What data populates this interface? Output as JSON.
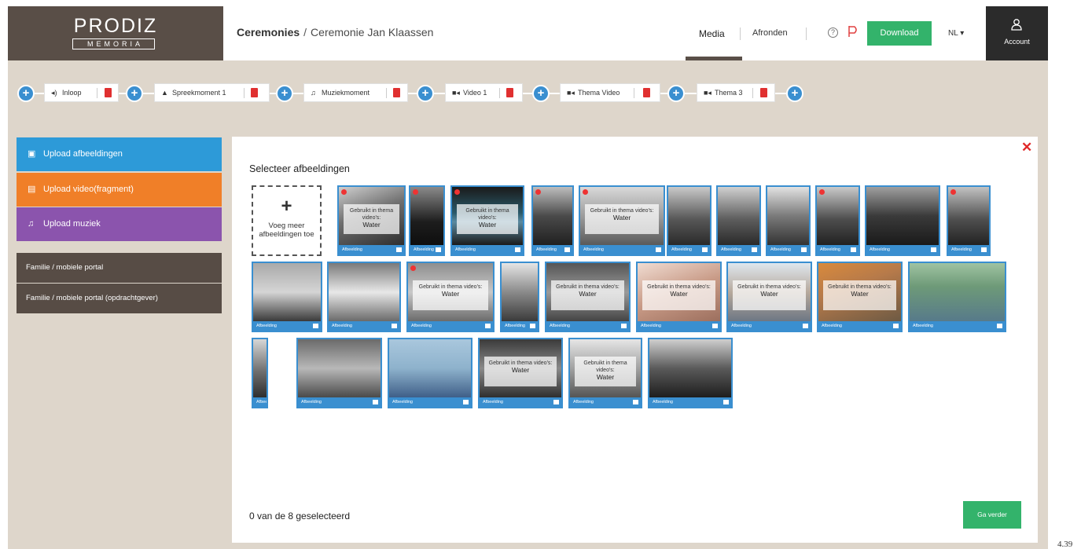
{
  "logo": {
    "main": "PRODIZ",
    "sub": "MEMORIA"
  },
  "breadcrumb": {
    "root": "Ceremonies",
    "separator": "/",
    "current": "Ceremonie Jan Klaassen"
  },
  "nav": {
    "media": "Media",
    "afronden": "Afronden",
    "help_icon": "?",
    "download": "Download",
    "language": "NL ▾",
    "account": "Account"
  },
  "timeline": [
    {
      "label": "Inloop",
      "icon": "speaker-icon",
      "glyph": "◂)"
    },
    {
      "label": "Spreekmoment 1",
      "icon": "person-icon",
      "glyph": "▲"
    },
    {
      "label": "Muziekmoment",
      "icon": "music-icon",
      "glyph": "♫"
    },
    {
      "label": "Video 1",
      "icon": "video-icon",
      "glyph": "■◂"
    },
    {
      "label": "Thema Video",
      "icon": "video-icon",
      "glyph": "■◂"
    },
    {
      "label": "Thema 3",
      "icon": "video-icon",
      "glyph": "■◂"
    }
  ],
  "sidebar": {
    "upload_images": "Upload afbeeldingen",
    "upload_video": "Upload video(fragment)",
    "upload_music": "Upload muziek",
    "family_portal": "Familie / mobiele portal",
    "family_portal_owner": "Familie / mobiele portal (opdrachtgever)"
  },
  "panel": {
    "title": "Selecteer afbeeldingen",
    "add_more_plus": "+",
    "add_more_label": "Voeg meer afbeeldingen toe",
    "close": "✕",
    "selected_count": "0 van de 8 geselecteerd",
    "continue": "Ga verder"
  },
  "thumbnail_caption": "Afbeelding",
  "overlay_text": {
    "used_a": "Gebruikt in thema video's:",
    "used_b": "Gebruikt in thema video's:",
    "theme": "Water"
  },
  "page_number": "4.39",
  "colors": {
    "accent_blue": "#3a8fd0",
    "green": "#33b36b",
    "orange": "#f07f28",
    "purple": "#8b54ad",
    "brown": "#594e47",
    "red": "#e02828"
  }
}
